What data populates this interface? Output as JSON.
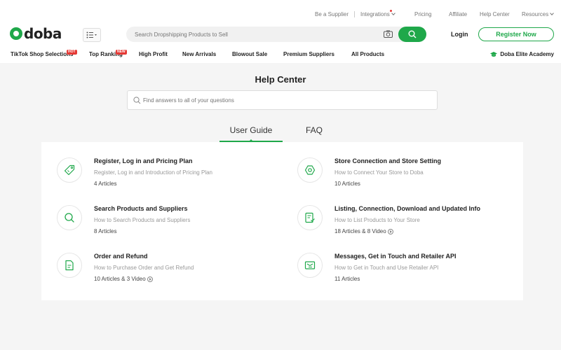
{
  "topbar": {
    "be_supplier": "Be a Supplier",
    "integrations": "Integrations",
    "pricing": "Pricing",
    "affiliate": "Affiliate",
    "help_center": "Help Center",
    "resources": "Resources"
  },
  "header": {
    "logo_text": "doba",
    "search_placeholder": "Search Dropshipping Products to Sell",
    "login": "Login",
    "register": "Register Now"
  },
  "nav": {
    "items": [
      {
        "label": "TikTok Shop Selections",
        "badge": "HOT"
      },
      {
        "label": "Top Ranking",
        "badge": "NEW"
      },
      {
        "label": "High Profit"
      },
      {
        "label": "New Arrivals"
      },
      {
        "label": "Blowout Sale"
      },
      {
        "label": "Premium Suppliers"
      },
      {
        "label": "All Products"
      }
    ],
    "academy": "Doba Elite Academy"
  },
  "main": {
    "title": "Help Center",
    "search_placeholder": "Find answers to all of your questions",
    "tabs": [
      "User Guide",
      "FAQ"
    ],
    "topics": [
      {
        "icon": "tag-icon",
        "title": "Register, Log in and Pricing Plan",
        "subtitle": "Register, Log in and Introduction of Pricing Plan",
        "count": "4 Articles"
      },
      {
        "icon": "store-settings-icon",
        "title": "Store Connection and Store Setting",
        "subtitle": "How to Connect Your Store to Doba",
        "count": "10 Articles"
      },
      {
        "icon": "search-icon",
        "title": "Search Products and Suppliers",
        "subtitle": "How to Search Products and Suppliers",
        "count": "8 Articles"
      },
      {
        "icon": "checklist-icon",
        "title": "Listing, Connection, Download and Updated Info",
        "subtitle": "How to List Products to Your Store",
        "count": "18 Articles & 8 Video"
      },
      {
        "icon": "document-icon",
        "title": "Order and Refund",
        "subtitle": "How to Purchase Order and Get Refund",
        "count": "10 Articles & 3 Video"
      },
      {
        "icon": "api-icon",
        "title": "Messages, Get in Touch and Retailer API",
        "subtitle": "How to Get in Touch and Use Retailer API",
        "count": "11 Articles"
      }
    ]
  },
  "colors": {
    "brand_green": "#1fa84a",
    "hot_badge": "#e53935"
  }
}
